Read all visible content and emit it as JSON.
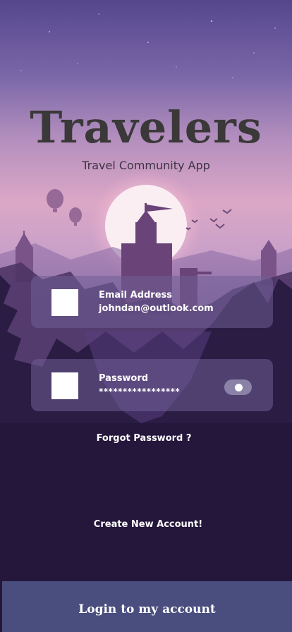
{
  "header": {
    "title": "Travelers",
    "subtitle": "Travel Community App"
  },
  "form": {
    "email": {
      "label": "Email Address",
      "value": "johndan@outlook.com",
      "icon": "envelope-icon"
    },
    "password": {
      "label": "Password",
      "value": "*****************",
      "icon": "lock-icon",
      "visibility_toggle": "eye-icon"
    }
  },
  "links": {
    "forgot_password": "Forgot Password ?",
    "create_account": "Create New Account!"
  },
  "actions": {
    "login_label": "Login to my account"
  },
  "colors": {
    "sky_top": "#5a4a91",
    "sky_glow": "#e7a3c4",
    "silhouette": "#24173b",
    "title": "#3a3838",
    "field_bg": "#705e96",
    "button_bg": "#4a4e7e"
  }
}
